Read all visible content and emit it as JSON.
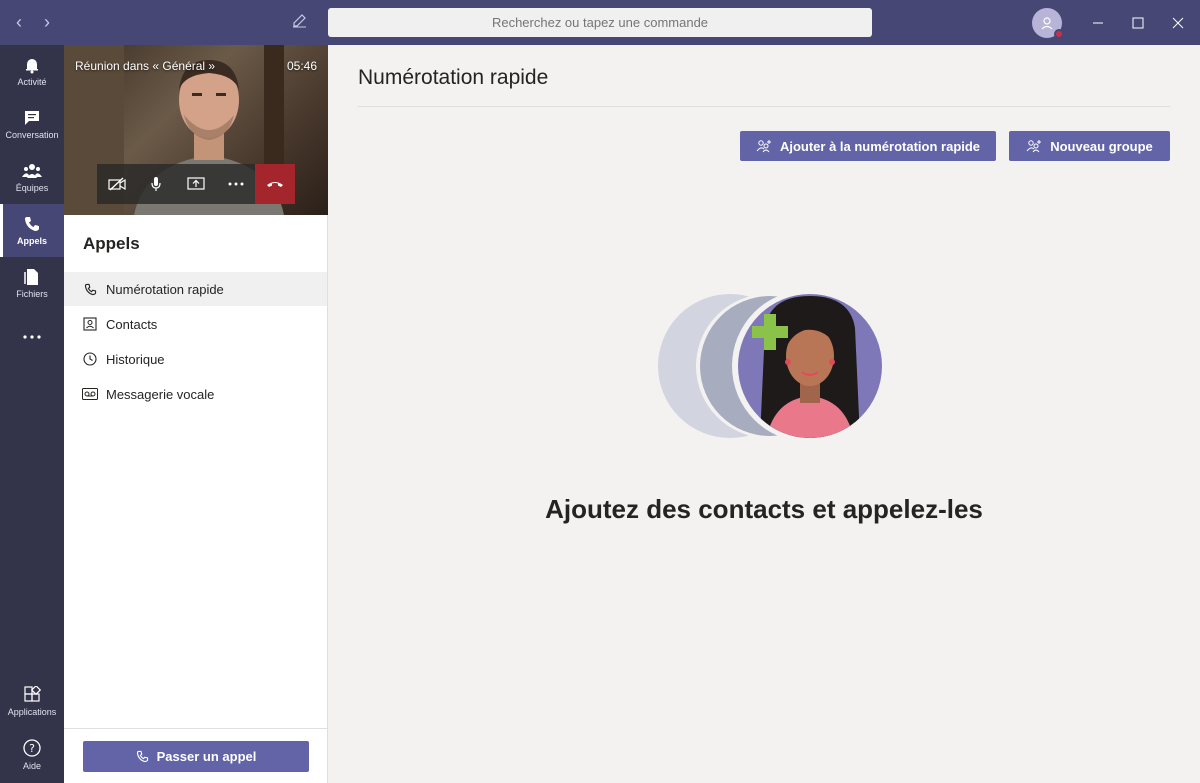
{
  "titlebar": {
    "back_icon": "chevron-left-icon",
    "forward_icon": "chevron-right-icon",
    "compose_icon": "compose-icon",
    "search_placeholder": "Recherchez ou tapez une commande",
    "avatar_status_color": "#c4314b"
  },
  "rail": {
    "items": [
      {
        "label": "Activité",
        "icon": "bell-icon"
      },
      {
        "label": "Conversation",
        "icon": "chat-icon"
      },
      {
        "label": "Équipes",
        "icon": "teams-icon"
      },
      {
        "label": "Appels",
        "icon": "phone-icon",
        "active": true
      },
      {
        "label": "Fichiers",
        "icon": "file-icon"
      },
      {
        "label": "",
        "icon": "more-icon"
      }
    ],
    "bottom": [
      {
        "label": "Applications",
        "icon": "apps-icon"
      },
      {
        "label": "Aide",
        "icon": "help-icon"
      }
    ]
  },
  "meeting": {
    "title": "Réunion dans « Général »",
    "time": "05:46"
  },
  "panel": {
    "title": "Appels",
    "items": [
      {
        "label": "Numérotation rapide",
        "icon": "phone-icon",
        "active": true
      },
      {
        "label": "Contacts",
        "icon": "contacts-icon"
      },
      {
        "label": "Historique",
        "icon": "clock-icon"
      },
      {
        "label": "Messagerie vocale",
        "icon": "voicemail-icon"
      }
    ],
    "call_button": "Passer un appel"
  },
  "main": {
    "title": "Numérotation rapide",
    "add_speed_dial": "Ajouter à la numérotation rapide",
    "new_group": "Nouveau groupe",
    "empty_text": "Ajoutez des contacts et appelez-les"
  },
  "colors": {
    "accent": "#6264a7",
    "titlebar": "#464775",
    "rail": "#33344a",
    "hangup": "#a4262c"
  }
}
